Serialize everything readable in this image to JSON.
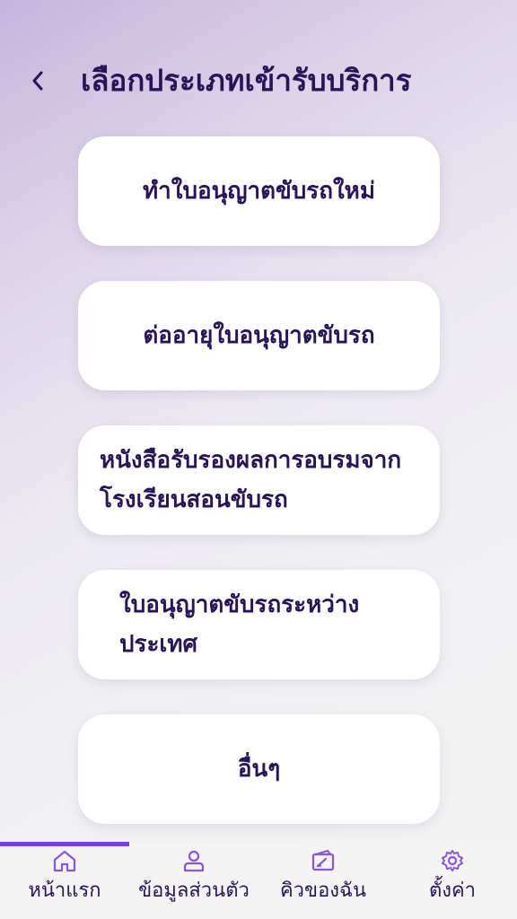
{
  "header": {
    "title": "เลือกประเภทเข้ารับบริการ"
  },
  "options": [
    {
      "label": "ทำใบอนุญาตขับรถใหม่"
    },
    {
      "label": "ต่ออายุใบอนุญาตขับรถ"
    },
    {
      "label": "หนังสือรับรองผลการอบรมจากโรงเรียนสอนขับรถ"
    },
    {
      "label": "ใบอนุญาตขับรถระหว่างประเทศ"
    },
    {
      "label": "อื่นๆ"
    }
  ],
  "nav": {
    "items": [
      {
        "label": "หน้าแรก",
        "icon": "home-icon",
        "active": true
      },
      {
        "label": "ข้อมูลส่วนตัว",
        "icon": "user-icon",
        "active": false
      },
      {
        "label": "คิวของฉัน",
        "icon": "ticket-icon",
        "active": false
      },
      {
        "label": "ตั้งค่า",
        "icon": "gear-icon",
        "active": false
      }
    ]
  },
  "colors": {
    "text": "#2a1458",
    "accent": "#7b3fe0",
    "icon": "#8a55d8"
  }
}
